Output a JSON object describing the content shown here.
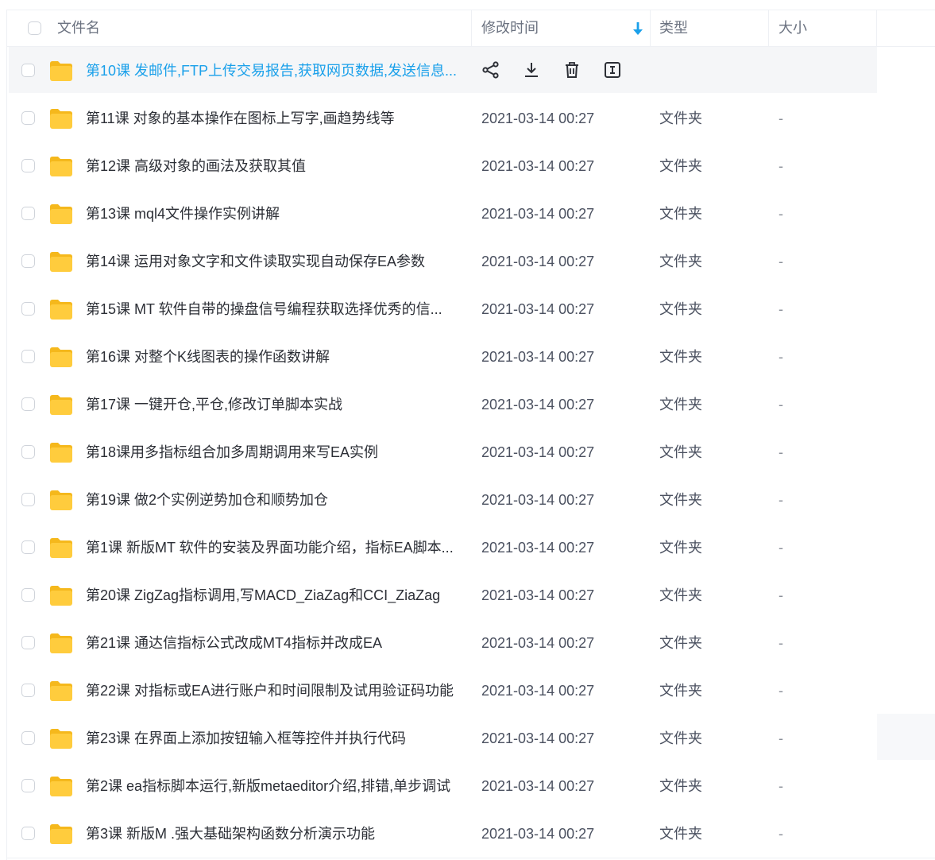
{
  "header": {
    "name": "文件名",
    "modified": "修改时间",
    "type": "类型",
    "size": "大小"
  },
  "colors": {
    "accent": "#1aa0ea",
    "folder_front": "#ffcc3d",
    "folder_back": "#f5b81c",
    "hover_bg": "#f5f6f8"
  },
  "hover_actions": [
    "share-icon",
    "download-icon",
    "delete-icon",
    "rename-icon"
  ],
  "rows": [
    {
      "name": "第10课 发邮件,FTP上传交易报告,获取网页数据,发送信息...",
      "time": "",
      "type": "",
      "size": "",
      "hover": true
    },
    {
      "name": "第11课 对象的基本操作在图标上写字,画趋势线等",
      "time": "2021-03-14 00:27",
      "type": "文件夹",
      "size": "-"
    },
    {
      "name": "第12课 高级对象的画法及获取其值",
      "time": "2021-03-14 00:27",
      "type": "文件夹",
      "size": "-"
    },
    {
      "name": "第13课 mql4文件操作实例讲解",
      "time": "2021-03-14 00:27",
      "type": "文件夹",
      "size": "-"
    },
    {
      "name": "第14课 运用对象文字和文件读取实现自动保存EA参数",
      "time": "2021-03-14 00:27",
      "type": "文件夹",
      "size": "-"
    },
    {
      "name": "第15课 MT  软件自带的操盘信号编程获取选择优秀的信...",
      "time": "2021-03-14 00:27",
      "type": "文件夹",
      "size": "-"
    },
    {
      "name": "第16课 对整个K线图表的操作函数讲解",
      "time": "2021-03-14 00:27",
      "type": "文件夹",
      "size": "-"
    },
    {
      "name": "第17课 一键开仓,平仓,修改订单脚本实战",
      "time": "2021-03-14 00:27",
      "type": "文件夹",
      "size": "-"
    },
    {
      "name": "第18课用多指标组合加多周期调用来写EA实例",
      "time": "2021-03-14 00:27",
      "type": "文件夹",
      "size": "-"
    },
    {
      "name": "第19课 做2个实例逆势加仓和顺势加仓",
      "time": "2021-03-14 00:27",
      "type": "文件夹",
      "size": "-"
    },
    {
      "name": "第1课 新版MT  软件的安装及界面功能介绍，指标EA脚本...",
      "time": "2021-03-14 00:27",
      "type": "文件夹",
      "size": "-"
    },
    {
      "name": "第20课 ZigZag指标调用,写MACD_ZiaZag和CCI_ZiaZag",
      "time": "2021-03-14 00:27",
      "type": "文件夹",
      "size": "-"
    },
    {
      "name": "第21课 通达信指标公式改成MT4指标并改成EA",
      "time": "2021-03-14 00:27",
      "type": "文件夹",
      "size": "-"
    },
    {
      "name": "第22课 对指标或EA进行账户和时间限制及试用验证码功能",
      "time": "2021-03-14 00:27",
      "type": "文件夹",
      "size": "-"
    },
    {
      "name": "第23课 在界面上添加按钮输入框等控件并执行代码",
      "time": "2021-03-14 00:27",
      "type": "文件夹",
      "size": "-"
    },
    {
      "name": "第2课 ea指标脚本运行,新版metaeditor介绍,排错,单步调试",
      "time": "2021-03-14 00:27",
      "type": "文件夹",
      "size": "-"
    },
    {
      "name": "第3课 新版M  .强大基础架构函数分析演示功能",
      "time": "2021-03-14 00:27",
      "type": "文件夹",
      "size": "-"
    }
  ]
}
